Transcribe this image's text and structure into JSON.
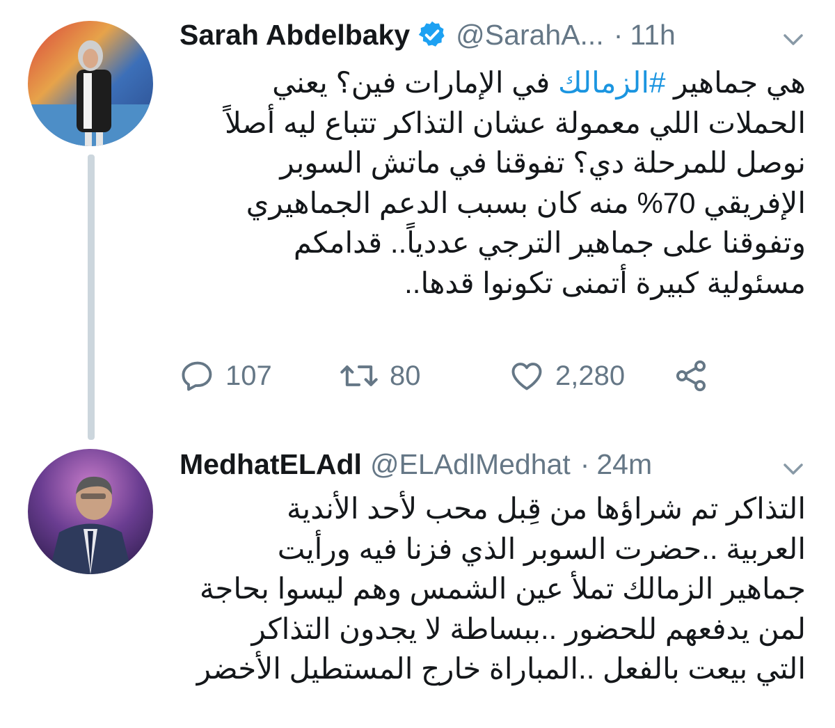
{
  "tweets": [
    {
      "author": {
        "name": "Sarah Abdelbaky",
        "handle": "@SarahA...",
        "verified": true
      },
      "separator": "·",
      "time": "11h",
      "text_lines": [
        {
          "pre": "هي جماهير ",
          "hashtag": "#الزمالك",
          "post": " في الإمارات فين؟ يعني"
        },
        {
          "pre": "الحملات اللي معمولة عشان التذاكر تتباع ليه أصلاً",
          "hashtag": "",
          "post": ""
        },
        {
          "pre": "نوصل للمرحلة دي؟ تفوقنا في ماتش السوبر",
          "hashtag": "",
          "post": ""
        },
        {
          "pre": "الإفريقي 70% منه كان بسبب الدعم الجماهيري",
          "hashtag": "",
          "post": ""
        },
        {
          "pre": "وتفوقنا على جماهير الترجي عددياً.. قدامكم",
          "hashtag": "",
          "post": ""
        },
        {
          "pre": "مسئولية كبيرة أتمنى تكونوا قدها..",
          "hashtag": "",
          "post": ""
        }
      ],
      "stats": {
        "replies": "107",
        "retweets": "80",
        "likes": "2,280"
      }
    },
    {
      "author": {
        "name": "MedhatELAdl",
        "handle": "@ELAdlMedhat",
        "verified": false
      },
      "separator": "·",
      "time": "24m",
      "text_lines": [
        "التذاكر تم شراؤها من قِبل محب لأحد الأندية",
        "العربية ..حضرت السوبر الذي فزنا فيه ورأيت",
        "جماهير الزمالك تملأ عين الشمس وهم ليسوا بحاجة",
        "لمن يدفعهم للحضور ..ببساطة لا يجدون التذاكر",
        "التي بيعت بالفعل ..المباراة خارج المستطيل الأخضر"
      ]
    }
  ],
  "icons": {
    "verified": "verified-badge-icon",
    "reply": "reply-icon",
    "retweet": "retweet-icon",
    "like": "heart-icon",
    "share": "share-icon",
    "menu": "chevron-down-icon"
  },
  "colors": {
    "text": "#14171a",
    "secondary": "#657786",
    "accent": "#1b95e0",
    "thread_line": "#ccd6dd"
  }
}
